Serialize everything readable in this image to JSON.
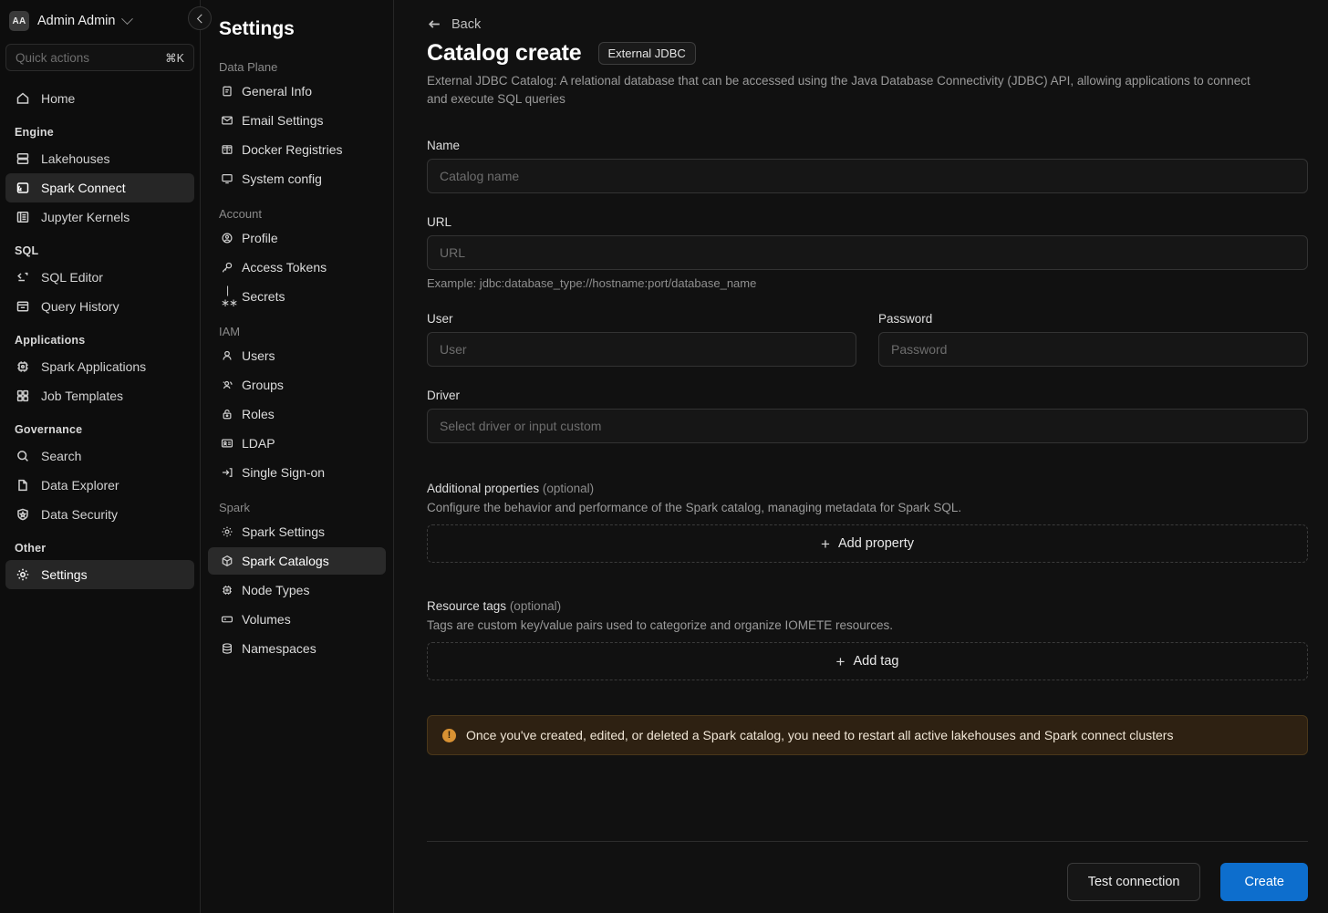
{
  "sidebar": {
    "user": {
      "initials": "AA",
      "name": "Admin Admin"
    },
    "collapse_label": "collapse-sidebar",
    "quick_actions": {
      "placeholder": "Quick actions",
      "shortcut": "⌘K"
    },
    "top_items": [
      {
        "label": "Home",
        "icon": "home-icon"
      }
    ],
    "groups": [
      {
        "title": "Engine",
        "items": [
          {
            "label": "Lakehouses",
            "icon": "lakehouse-icon"
          },
          {
            "label": "Spark Connect",
            "icon": "spark-connect-icon",
            "active": true
          },
          {
            "label": "Jupyter Kernels",
            "icon": "jupyter-icon"
          }
        ]
      },
      {
        "title": "SQL",
        "items": [
          {
            "label": "SQL Editor",
            "icon": "code-icon"
          },
          {
            "label": "Query History",
            "icon": "history-icon"
          }
        ]
      },
      {
        "title": "Applications",
        "items": [
          {
            "label": "Spark Applications",
            "icon": "chip-icon"
          },
          {
            "label": "Job Templates",
            "icon": "grid-icon"
          }
        ]
      },
      {
        "title": "Governance",
        "items": [
          {
            "label": "Search",
            "icon": "search-icon"
          },
          {
            "label": "Data Explorer",
            "icon": "document-icon"
          },
          {
            "label": "Data Security",
            "icon": "shield-icon"
          }
        ]
      },
      {
        "title": "Other",
        "items": [
          {
            "label": "Settings",
            "icon": "gear-icon",
            "active": true
          }
        ]
      }
    ]
  },
  "subnav": {
    "title": "Settings",
    "groups": [
      {
        "title": "Data Plane",
        "items": [
          {
            "label": "General Info",
            "icon": "notebook-icon"
          },
          {
            "label": "Email Settings",
            "icon": "envelope-icon"
          },
          {
            "label": "Docker Registries",
            "icon": "registry-icon"
          },
          {
            "label": "System config",
            "icon": "monitor-icon"
          }
        ]
      },
      {
        "title": "Account",
        "items": [
          {
            "label": "Profile",
            "icon": "user-circle-icon"
          },
          {
            "label": "Access Tokens",
            "icon": "key-icon"
          },
          {
            "label": "Secrets",
            "icon": "asterisk-icon"
          }
        ]
      },
      {
        "title": "IAM",
        "items": [
          {
            "label": "Users",
            "icon": "user-icon"
          },
          {
            "label": "Groups",
            "icon": "users-icon"
          },
          {
            "label": "Roles",
            "icon": "lock-icon"
          },
          {
            "label": "LDAP",
            "icon": "id-card-icon"
          },
          {
            "label": "Single Sign-on",
            "icon": "sign-in-icon"
          }
        ]
      },
      {
        "title": "Spark",
        "items": [
          {
            "label": "Spark Settings",
            "icon": "gear-icon"
          },
          {
            "label": "Spark Catalogs",
            "icon": "cube-icon",
            "active": true
          },
          {
            "label": "Node Types",
            "icon": "cpu-icon"
          },
          {
            "label": "Volumes",
            "icon": "volume-icon"
          },
          {
            "label": "Namespaces",
            "icon": "database-icon"
          }
        ]
      }
    ]
  },
  "main": {
    "back_label": "Back",
    "title": "Catalog create",
    "badge": "External JDBC",
    "description": "External JDBC Catalog: A relational database that can be accessed using the Java Database Connectivity (JDBC) API, allowing applications to connect and execute SQL queries",
    "fields": {
      "name": {
        "label": "Name",
        "value": "",
        "placeholder": "Catalog name"
      },
      "url": {
        "label": "URL",
        "value": "",
        "placeholder": "URL",
        "hint": "Example: jdbc:database_type://hostname:port/database_name"
      },
      "user": {
        "label": "User",
        "value": "",
        "placeholder": "User"
      },
      "password": {
        "label": "Password",
        "value": "",
        "placeholder": "Password"
      },
      "driver": {
        "label": "Driver",
        "value": "",
        "placeholder": "Select driver or input custom"
      }
    },
    "additional_properties": {
      "title": "Additional properties",
      "optional": "(optional)",
      "description": "Configure the behavior and performance of the Spark catalog, managing metadata for Spark SQL.",
      "add_label": "Add property",
      "plus": "+"
    },
    "resource_tags": {
      "title": "Resource tags",
      "optional": "(optional)",
      "description": "Tags are custom key/value pairs used to categorize and organize IOMETE resources.",
      "add_label": "Add tag",
      "plus": "+"
    },
    "warning": {
      "icon": "!",
      "text": "Once you've created, edited, or deleted a Spark catalog, you need to restart all active lakehouses and Spark connect clusters"
    },
    "footer": {
      "test_connection_label": "Test connection",
      "create_label": "Create"
    }
  },
  "colors": {
    "accent": "#0d6ecd",
    "warning": "#d99233",
    "page_bg": "#111111",
    "sidebar_bg": "#0d0d0d"
  }
}
